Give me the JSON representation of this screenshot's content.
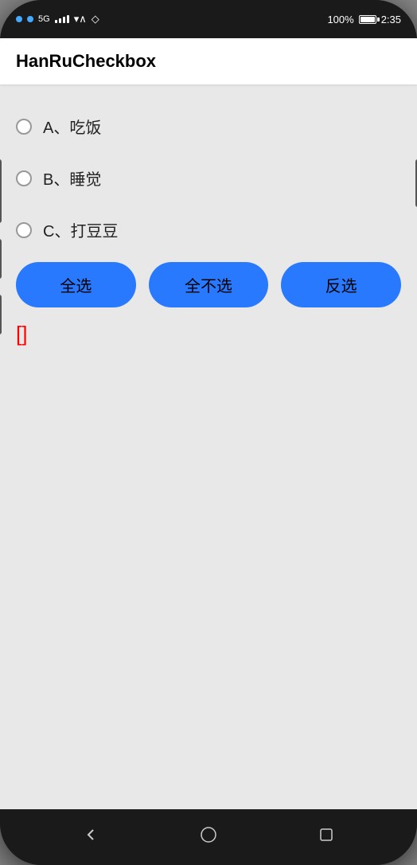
{
  "status_bar": {
    "battery": "100%",
    "time": "2:35",
    "signal": "5G"
  },
  "app": {
    "title": "HanRuCheckbox"
  },
  "checkboxes": [
    {
      "id": "a",
      "label": "A、吃饭",
      "checked": false
    },
    {
      "id": "b",
      "label": "B、睡觉",
      "checked": false
    },
    {
      "id": "c",
      "label": "C、打豆豆",
      "checked": false
    }
  ],
  "buttons": {
    "select_all": "全选",
    "deselect_all": "全不选",
    "invert": "反选"
  },
  "result": {
    "prefix": "[",
    "suffix": "]",
    "value": ""
  },
  "nav": {
    "back": "‹",
    "home": "○",
    "recent": "□"
  }
}
